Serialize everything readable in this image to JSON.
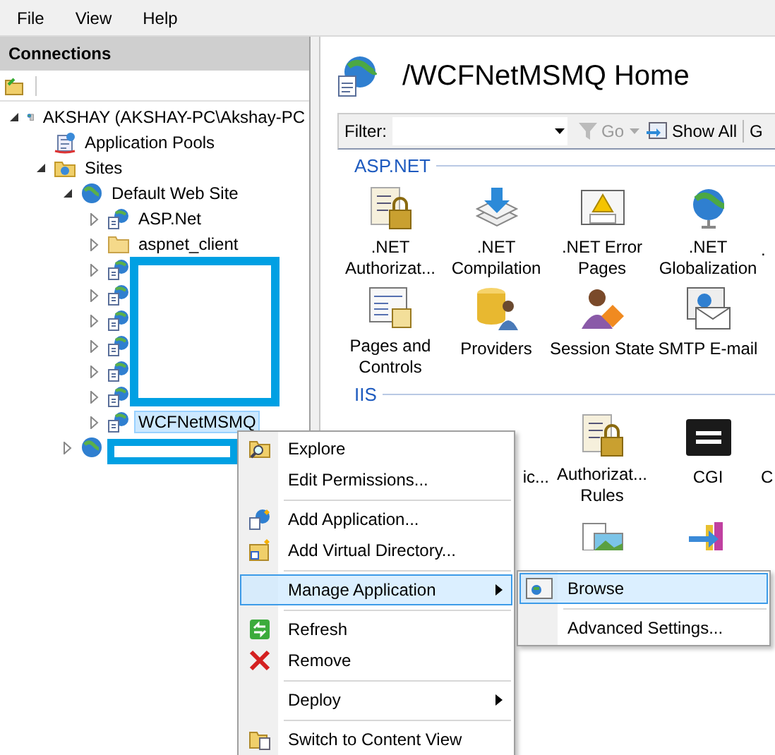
{
  "menu_bar": [
    {
      "label": "File"
    },
    {
      "label": "View"
    },
    {
      "label": "Help"
    }
  ],
  "connections": {
    "title": "Connections",
    "tree": [
      {
        "label": "AKSHAY (AKSHAY-PC\\Akshay-PC",
        "kind": "server",
        "expanded": true,
        "selected": false,
        "children": [
          {
            "label": "Application Pools",
            "kind": "pool",
            "selected": false
          },
          {
            "label": "Sites",
            "kind": "sites",
            "expanded": true,
            "selected": false,
            "children": [
              {
                "label": "Default Web Site",
                "kind": "globe",
                "expanded": true,
                "selected": false,
                "children": [
                  {
                    "label": "ASP.Net",
                    "kind": "app",
                    "expanded": false,
                    "selected": false
                  },
                  {
                    "label": "aspnet_client",
                    "kind": "folder",
                    "expanded": false,
                    "selected": false
                  },
                  {
                    "kind": "app",
                    "expanded": false,
                    "selected": false
                  },
                  {
                    "kind": "app",
                    "expanded": false,
                    "selected": false
                  },
                  {
                    "kind": "app",
                    "expanded": false,
                    "selected": false
                  },
                  {
                    "kind": "app",
                    "expanded": false,
                    "selected": false
                  },
                  {
                    "kind": "app",
                    "expanded": false,
                    "selected": false
                  },
                  {
                    "kind": "app",
                    "expanded": false,
                    "selected": false
                  },
                  {
                    "label": "WCFNetMSMQ",
                    "kind": "app",
                    "expanded": false,
                    "selected": true
                  }
                ]
              },
              {
                "kind": "globe",
                "expanded": false,
                "selected": false
              }
            ]
          }
        ]
      }
    ]
  },
  "content": {
    "title": "/WCFNetMSMQ Home",
    "filter_bar": {
      "label": "Filter:",
      "go": {
        "label": "Go",
        "disabled": true
      },
      "show_all": "Show All",
      "cut_button": "G"
    },
    "groups": [
      {
        "title": "ASP.NET",
        "rows": [
          [
            {
              "kind": "list-lock",
              "label": ".NET Authorizat..."
            },
            {
              "kind": "stack",
              "label": ".NET Compilation"
            },
            {
              "kind": "warning",
              "label": ".NET Error Pages"
            },
            {
              "kind": "globe",
              "label": ".NET Globalization"
            },
            {
              "kind": "none",
              "label": "."
            }
          ],
          [
            {
              "kind": "form",
              "label": "Pages and Controls"
            },
            {
              "kind": "cylinder",
              "label": "Providers"
            },
            {
              "kind": "person",
              "label": "Session State"
            },
            {
              "kind": "envelope",
              "label": "SMTP E-mail"
            }
          ]
        ]
      },
      {
        "title": "IIS",
        "rows": [
          [
            {
              "kind": "none"
            },
            {
              "kind": "none",
              "label": "ic..."
            },
            {
              "kind": "list-lock",
              "label": "Authorizat... Rules"
            },
            {
              "kind": "cgi",
              "label": "CGI"
            },
            {
              "kind": "none",
              "label": "C"
            }
          ],
          [
            {
              "kind": "none"
            },
            {
              "kind": "none"
            },
            {
              "kind": "picture"
            },
            {
              "kind": "arrows"
            }
          ]
        ]
      }
    ]
  },
  "context_menu": {
    "items": [
      {
        "kind": "explore",
        "label": "Explore",
        "submenu": false,
        "selected": false
      },
      {
        "kind": "plain",
        "label": "Edit Permissions...",
        "submenu": false,
        "selected": false
      },
      {
        "kind": "separator"
      },
      {
        "kind": "add-app",
        "label": "Add Application...",
        "submenu": false,
        "selected": false
      },
      {
        "kind": "add-dir",
        "label": "Add Virtual Directory...",
        "submenu": false,
        "selected": false
      },
      {
        "kind": "separator"
      },
      {
        "kind": "plain",
        "label": "Manage Application",
        "submenu": true,
        "selected": true
      },
      {
        "kind": "separator"
      },
      {
        "kind": "refresh",
        "label": "Refresh",
        "submenu": false,
        "selected": false
      },
      {
        "kind": "remove",
        "label": "Remove",
        "submenu": false,
        "selected": false
      },
      {
        "kind": "separator"
      },
      {
        "kind": "plain",
        "label": "Deploy",
        "submenu": true,
        "selected": false
      },
      {
        "kind": "separator"
      },
      {
        "kind": "switch",
        "label": "Switch to Content View",
        "submenu": false,
        "selected": false
      }
    ]
  },
  "submenu": {
    "items": [
      {
        "kind": "browse",
        "label": "Browse",
        "selected": true
      },
      {
        "kind": "separator"
      },
      {
        "kind": "plain",
        "label": "Advanced Settings...",
        "selected": false
      }
    ]
  }
}
